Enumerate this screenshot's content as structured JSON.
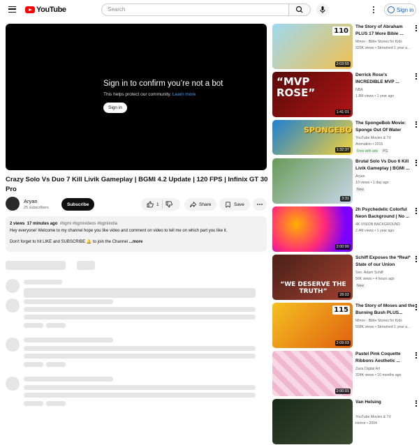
{
  "header": {
    "logo_text": "YouTube",
    "search_placeholder": "Search",
    "sign_in": "Sign in",
    "icons": [
      "menu-icon",
      "search-icon",
      "mic-icon",
      "more-icon",
      "account-icon"
    ]
  },
  "player": {
    "title": "Sign in to confirm you’re not a bot",
    "subtitle": "This helps protect our community.",
    "learn_more": "Learn more",
    "button": "Sign in"
  },
  "video": {
    "title": "Crazy Solo Vs Duo 7 Kill Livik Gameplay | BGMI 4.2 Update | 120 FPS | Infinix GT 30 Pro",
    "channel": "Aryan",
    "subscribers": "25 subscribers",
    "subscribe": "Subscribe",
    "likes": "1",
    "share": "Share",
    "save": "Save",
    "views": "2 views",
    "time": "17 minutes ago",
    "tags": "#bgmi #bgmivideos #bgmiindia",
    "desc_line1": "Hey everyone! Welcome to my channel hope you like video and comment on video to tell me on which part you like it.",
    "desc_line2": "Don't forget to hit LIKE and SUBSCRIBE 🔔 to join the Channel",
    "more": "...more"
  },
  "sidebar": [
    {
      "title": "The Story of Abraham PLUS 17 More Bible ...",
      "channel": "Minno - Bible Stories for Kids",
      "meta": "920K views • Streamed 1 year a...",
      "duration": "2:03:55",
      "thumb_colors": [
        "#9fd8f0",
        "#f0c050"
      ],
      "thumb_text": "110"
    },
    {
      "title": "Derrick Rose's INCREDIBLE MVP ...",
      "channel": "NBA",
      "meta": "1.8M views • 1 year ago",
      "duration": "1:41:01",
      "thumb_colors": [
        "#5a0a0a",
        "#b01515"
      ],
      "thumb_text": "“MVP ROSE”"
    },
    {
      "title": "The SpongeBob Movie: Sponge Out Of Water",
      "channel": "YouTube Movies & TV",
      "meta": "Animation • 2015",
      "badges": [
        "Free with ads",
        "PG"
      ],
      "duration": "1:32:37",
      "thumb_colors": [
        "#1e7fd0",
        "#f5d33a"
      ],
      "thumb_text": "SPONGEBOB"
    },
    {
      "title": "Brutal Solo Vs Duo 6 Kill Livik Gameplay | BGMI ...",
      "channel": "Aryan",
      "meta": "10 views • 1 day ago",
      "badges": [
        "New"
      ],
      "duration": "3:31",
      "thumb_colors": [
        "#6a9a5a",
        "#c8d8e8"
      ],
      "thumb_text": ""
    },
    {
      "title": "2h Psychedelic Colorful Neon Background | No ...",
      "channel": "4K VISION BACKGROUND",
      "meta": "2.4M views • 1 year ago",
      "duration": "2:00:00",
      "thumb_colors": [
        "#ff2a7a",
        "#ffb000"
      ],
      "thumb_text": ""
    },
    {
      "title": "Schiff Exposes the *Real* State of our Union",
      "channel": "Sen. Adam Schiff",
      "meta": "56K views • 4 hours ago",
      "badges": [
        "New"
      ],
      "duration": "28:02",
      "thumb_colors": [
        "#4a2018",
        "#a04030"
      ],
      "thumb_text": "“WE DESERVE THE TRUTH”"
    },
    {
      "title": "The Story of Moses and the Burning Bush PLUS...",
      "channel": "Minno - Bible Stories for Kids",
      "meta": "568K views • Streamed 1 year a...",
      "duration": "2:09:03",
      "thumb_colors": [
        "#f5c020",
        "#e06010"
      ],
      "thumb_text": "115"
    },
    {
      "title": "Pastel Pink Coquette Ribbons Aesthetic ...",
      "channel": "Zaza Digital Art",
      "meta": "324K views • 10 months ago",
      "duration": "2:00:01",
      "thumb_colors": [
        "#f8d8e4",
        "#f0b8cc"
      ],
      "thumb_text": ""
    },
    {
      "title": "Van Helsing",
      "channel": "YouTube Movies & TV",
      "meta": "Horror • 2004",
      "duration": "",
      "thumb_colors": [
        "#1a2a1a",
        "#3a4a30"
      ],
      "thumb_text": ""
    }
  ]
}
